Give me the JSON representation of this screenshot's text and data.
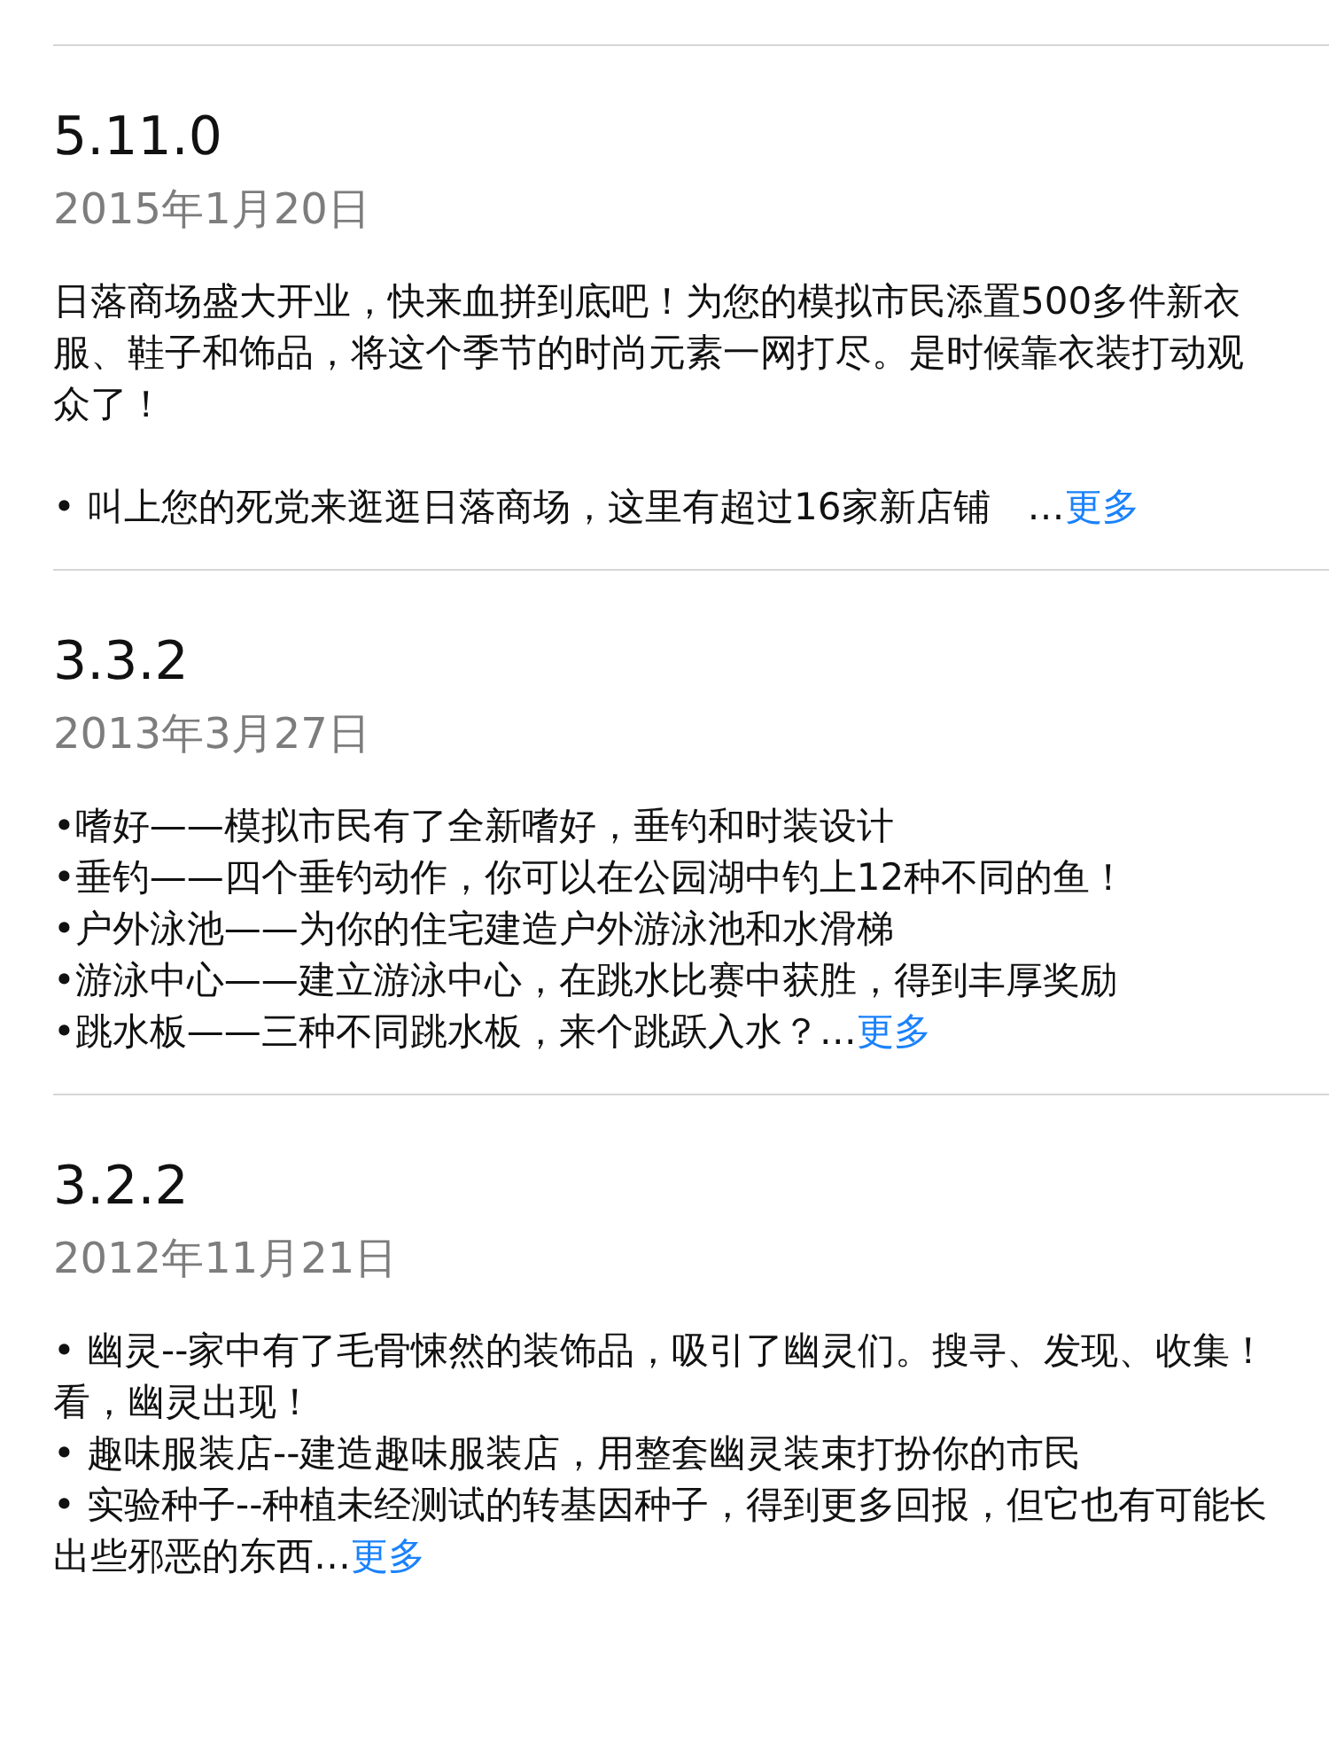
{
  "versions": [
    {
      "version": "5.11.0",
      "date": "2015年1月20日",
      "paragraphs": [
        [
          "日落商场盛大开业，快来血拼到底吧！为您的模拟市民添置500多件新衣服、鞋子和饰品，将这个季节的时尚元素一网打尽。是时候靠衣装打动观众了！"
        ],
        [
          "• 叫上您的死党来逛逛日落商场，这里有超过16家新店铺　…"
        ]
      ],
      "more": "更多"
    },
    {
      "version": "3.3.2",
      "date": "2013年3月27日",
      "paragraphs": [
        [
          "•嗜好——模拟市民有了全新嗜好，垂钓和时装设计",
          "•垂钓——四个垂钓动作，你可以在公园湖中钓上12种不同的鱼！",
          "•户外泳池——为你的住宅建造户外游泳池和水滑梯",
          "•游泳中心——建立游泳中心，在跳水比赛中获胜，得到丰厚奖励",
          "•跳水板——三种不同跳水板，来个跳跃入水？…"
        ]
      ],
      "more": "更多"
    },
    {
      "version": "3.2.2",
      "date": "2012年11月21日",
      "paragraphs": [
        [
          "• 幽灵--家中有了毛骨悚然的装饰品，吸引了幽灵们。搜寻、发现、收集！看，幽灵出现！",
          "• 趣味服装店--建造趣味服装店，用整套幽灵装束打扮你的市民",
          "• 实验种子--种植未经测试的转基因种子，得到更多回报，但它也有可能长出些邪恶的东西…"
        ]
      ],
      "more": "更多"
    }
  ]
}
